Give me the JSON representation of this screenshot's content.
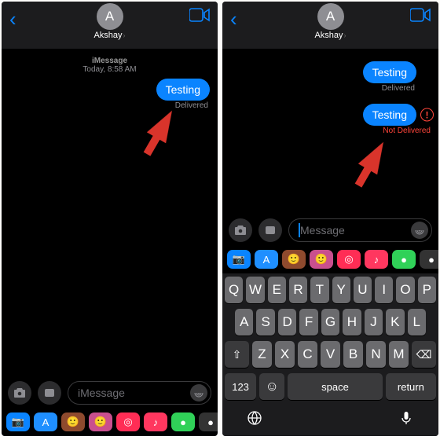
{
  "contact": {
    "initial": "A",
    "name": "Akshay"
  },
  "service_line": {
    "service": "iMessage",
    "time": "Today, 8:58 AM"
  },
  "messages": {
    "left_panel": [
      {
        "text": "Testing",
        "status": "Delivered",
        "error": false
      }
    ],
    "right_panel": [
      {
        "text": "Testing",
        "status": "Delivered",
        "error": false
      },
      {
        "text": "Testing",
        "status": "Not Delivered",
        "error": true
      }
    ]
  },
  "input": {
    "placeholder": "iMessage",
    "active_placeholder": "Message"
  },
  "keyboard": {
    "row1": [
      "Q",
      "W",
      "E",
      "R",
      "T",
      "Y",
      "U",
      "I",
      "O",
      "P"
    ],
    "row2": [
      "A",
      "S",
      "D",
      "F",
      "G",
      "H",
      "J",
      "K",
      "L"
    ],
    "row3": [
      "Z",
      "X",
      "C",
      "V",
      "B",
      "N",
      "M"
    ],
    "numkey": "123",
    "space": "space",
    "return": "return"
  },
  "app_strip": [
    {
      "bg": "#0a84ff",
      "glyph": "📷"
    },
    {
      "bg": "#1f8fff",
      "glyph": "A"
    },
    {
      "bg": "#8e4a2e",
      "glyph": "🙂"
    },
    {
      "bg": "#c94f8e",
      "glyph": "🙂"
    },
    {
      "bg": "#ff2d55",
      "glyph": "◎"
    },
    {
      "bg": "#ff375f",
      "glyph": "♪"
    },
    {
      "bg": "#30d158",
      "glyph": "●"
    },
    {
      "bg": "#333333",
      "glyph": "●"
    },
    {
      "bg": "#ff2d92",
      "glyph": "✦"
    }
  ]
}
